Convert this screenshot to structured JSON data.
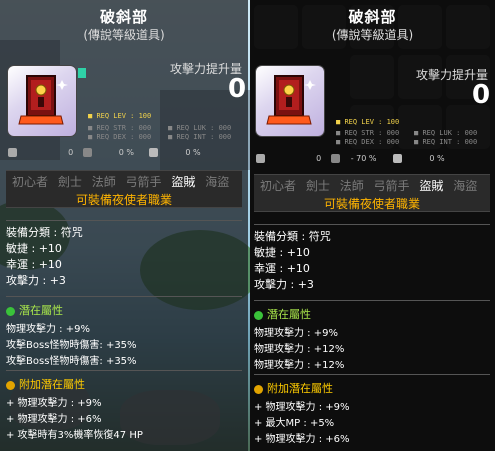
{
  "left": {
    "title": "破斜部",
    "subtitle": "(傳說等級道具)",
    "attack_increase_label": "攻擊力提升量",
    "attack_increase_value": "0",
    "req": {
      "lev": "REQ LEV : 100",
      "str": "REQ STR : 000",
      "luk": "REQ LUK : 000",
      "dex": "REQ DEX : 000",
      "int": "REQ INT : 000"
    },
    "mini": [
      "0",
      "0 %",
      "0 %"
    ],
    "jobs": [
      "初心者",
      "劍士",
      "法師",
      "弓箭手",
      "盜賊",
      "海盜"
    ],
    "active_job": "盜賊",
    "job_note": "可裝備夜使者職業",
    "stats": [
      "裝備分類 : 符咒",
      "敏捷 : +10",
      "幸運 : +10",
      "攻擊力 : +3"
    ],
    "potential_title": "潛在屬性",
    "potential": [
      "物理攻擊力 : +9%",
      "攻擊Boss怪物時傷害: +35%",
      "攻擊Boss怪物時傷害: +35%"
    ],
    "bonus_title": "附加潛在屬性",
    "bonus": [
      "+ 物理攻擊力 : +9%",
      "+ 物理攻擊力 : +6%",
      "+ 攻擊時有3%機率恢復47 HP"
    ]
  },
  "right": {
    "title": "破斜部",
    "subtitle": "(傳說等級道具)",
    "attack_increase_label": "攻擊力提升量",
    "attack_increase_value": "0",
    "req": {
      "lev": "REQ LEV : 100",
      "str": "REQ STR : 000",
      "luk": "REQ LUK : 000",
      "dex": "REQ DEX : 000",
      "int": "REQ INT : 000"
    },
    "mini": [
      "0",
      "- 70 %",
      "0 %"
    ],
    "jobs": [
      "初心者",
      "劍士",
      "法師",
      "弓箭手",
      "盜賊",
      "海盜"
    ],
    "active_job": "盜賊",
    "job_note": "可裝備夜使者職業",
    "stats": [
      "裝備分類 : 符咒",
      "敏捷 : +10",
      "幸運 : +10",
      "攻擊力 : +3"
    ],
    "potential_title": "潛在屬性",
    "potential": [
      "物理攻擊力 : +9%",
      "物理攻擊力 : +12%",
      "物理攻擊力 : +12%"
    ],
    "bonus_title": "附加潛在屬性",
    "bonus": [
      "+ 物理攻擊力 : +9%",
      "+ 最大MP : +5%",
      "+ 物理攻擊力 : +6%"
    ]
  },
  "colors": {
    "job_note": "#ffb400",
    "potential": "#a9e64b",
    "bonus": "#ffcc00",
    "req_lev": "#f1d24b"
  },
  "icons": {
    "item_icon": "charm-talisman-icon",
    "potential_icon": "green-potential-icon",
    "bonus_icon": "gold-bonus-potential-icon"
  }
}
